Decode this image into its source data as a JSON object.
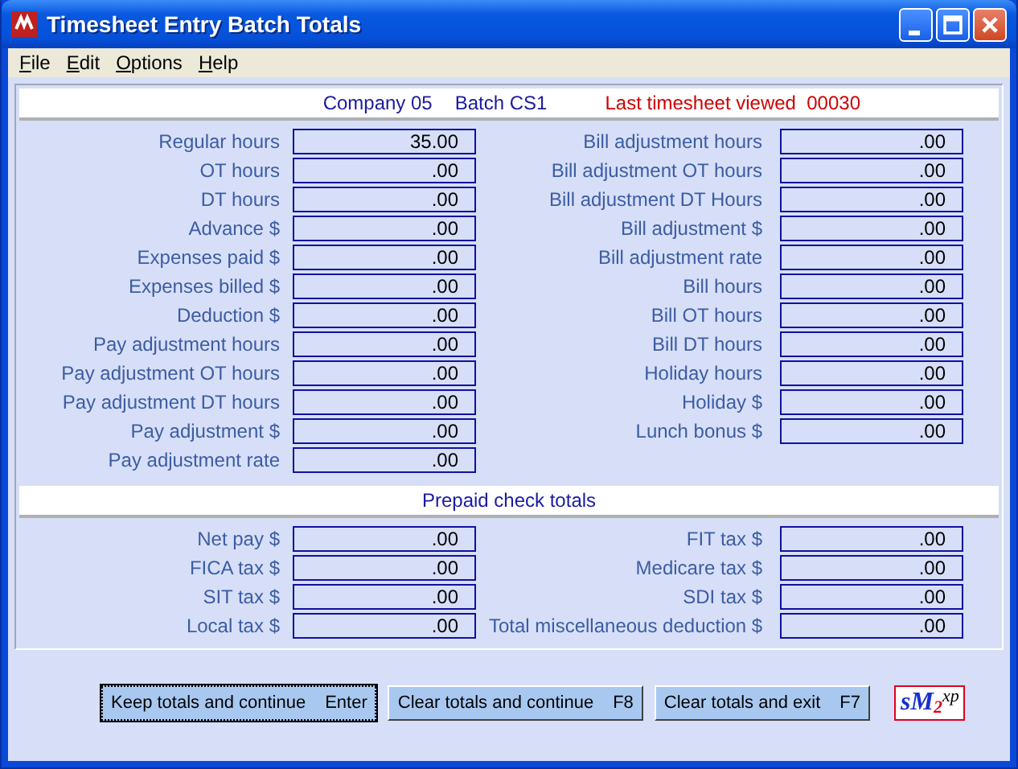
{
  "window": {
    "title": "Timesheet Entry Batch Totals"
  },
  "menu": [
    "File",
    "Edit",
    "Options",
    "Help"
  ],
  "header": {
    "company": "Company 05",
    "batch": "Batch CS1",
    "last_viewed": "Last timesheet viewed  00030"
  },
  "totals": {
    "left": [
      {
        "label": "Regular hours",
        "value": "35.00"
      },
      {
        "label": "OT hours",
        "value": ".00"
      },
      {
        "label": "DT hours",
        "value": ".00"
      },
      {
        "label": "Advance $",
        "value": ".00"
      },
      {
        "label": "Expenses paid $",
        "value": ".00"
      },
      {
        "label": "Expenses billed $",
        "value": ".00"
      },
      {
        "label": "Deduction $",
        "value": ".00"
      },
      {
        "label": "Pay adjustment hours",
        "value": ".00"
      },
      {
        "label": "Pay adjustment OT hours",
        "value": ".00"
      },
      {
        "label": "Pay adjustment DT hours",
        "value": ".00"
      },
      {
        "label": "Pay adjustment $",
        "value": ".00"
      },
      {
        "label": "Pay adjustment rate",
        "value": ".00"
      }
    ],
    "right": [
      {
        "label": "Bill adjustment hours",
        "value": ".00"
      },
      {
        "label": "Bill adjustment OT hours",
        "value": ".00"
      },
      {
        "label": "Bill adjustment DT Hours",
        "value": ".00"
      },
      {
        "label": "Bill adjustment $",
        "value": ".00"
      },
      {
        "label": "Bill adjustment rate",
        "value": ".00"
      },
      {
        "label": "Bill hours",
        "value": ".00"
      },
      {
        "label": "Bill OT hours",
        "value": ".00"
      },
      {
        "label": "Bill DT hours",
        "value": ".00"
      },
      {
        "label": "Holiday hours",
        "value": ".00"
      },
      {
        "label": "Holiday $",
        "value": ".00"
      },
      {
        "label": "Lunch bonus $",
        "value": ".00"
      }
    ]
  },
  "prepaid": {
    "title": "Prepaid check totals",
    "left": [
      {
        "label": "Net pay $",
        "value": ".00"
      },
      {
        "label": "FICA tax $",
        "value": ".00"
      },
      {
        "label": "SIT tax $",
        "value": ".00"
      },
      {
        "label": "Local tax $",
        "value": ".00"
      }
    ],
    "right": [
      {
        "label": "FIT tax $",
        "value": ".00"
      },
      {
        "label": "Medicare tax $",
        "value": ".00"
      },
      {
        "label": "SDI tax $",
        "value": ".00"
      },
      {
        "label": "Total miscellaneous deduction $",
        "value": ".00"
      }
    ]
  },
  "buttons": [
    {
      "label": "Keep totals and continue",
      "key": "Enter",
      "selected": true
    },
    {
      "label": "Clear totals and continue",
      "key": "F8",
      "selected": false
    },
    {
      "label": "Clear totals and exit",
      "key": "F7",
      "selected": false
    }
  ],
  "logo": "sM$_{2}$$^{xp}$"
}
